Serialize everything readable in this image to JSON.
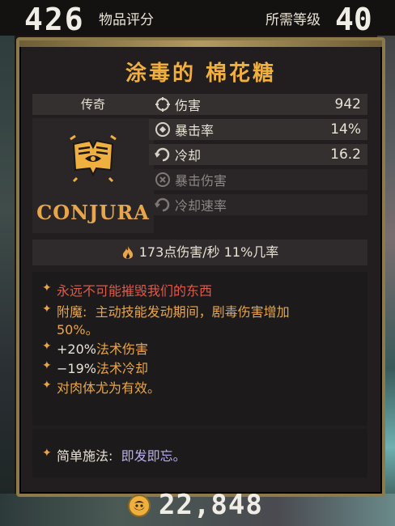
{
  "header": {
    "item_score": "426",
    "item_score_label": "物品评分",
    "required_level_label": "所需等级",
    "required_level": "40"
  },
  "item": {
    "name": "涂毒的 棉花糖",
    "rarity": "传奇",
    "brand": "CONJURA"
  },
  "stats": [
    {
      "icon": "damage-icon",
      "label": "伤害",
      "value": "942",
      "active": true
    },
    {
      "icon": "crit-rate-icon",
      "label": "暴击率",
      "value": "14%",
      "active": true
    },
    {
      "icon": "cooldown-icon",
      "label": "冷却",
      "value": "16.2",
      "active": true
    },
    {
      "icon": "crit-damage-icon",
      "label": "暴击伤害",
      "value": "",
      "active": false
    },
    {
      "icon": "cooldown-rate-icon",
      "label": "冷却速率",
      "value": "",
      "active": false
    }
  ],
  "dps_line": "173点伤害/秒  11%几率",
  "description": {
    "flavor": "永远不可能摧毁我们的东西",
    "enchant_label": "附魔:",
    "enchant_text_1": "主动技能发动期间，剧毒伤害增加",
    "enchant_text_2": "50%。",
    "bonus_1_value": "+20%",
    "bonus_1_text": "法术伤害",
    "bonus_2_value": "−19%",
    "bonus_2_text": "法术冷却",
    "bonus_3": "对肉体尤为有效。"
  },
  "casting": {
    "label": "简单施法:",
    "value": "即发即忘。"
  },
  "price": "22,848",
  "colors": {
    "title_gold": "#f0b040",
    "accent_orange": "#e8a64a",
    "flavor_red": "#e05a4a",
    "cast_value_purple": "#b8b0ee"
  }
}
